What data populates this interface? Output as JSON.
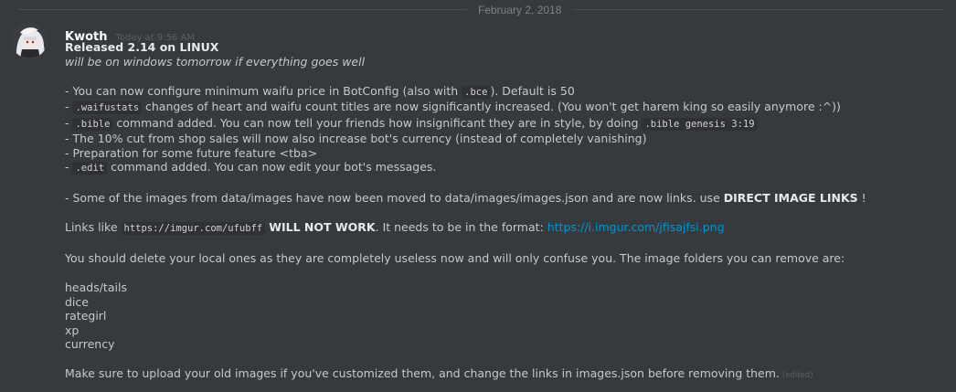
{
  "divider": {
    "date": "February 2, 2018"
  },
  "message": {
    "author": "Kwoth",
    "timestamp": "Today at 9:56 AM",
    "title": "Released 2.14 on LINUX",
    "subtitle": "will be on windows tomorrow if everything goes well",
    "changes": [
      {
        "pre": "- You can now configure minimum waifu price in BotConfig (also with ",
        "code": ".bce",
        "post": "). Default is 50"
      },
      {
        "pre": "- ",
        "code": ".waifustats",
        "post": " changes of heart and waifu count titles are now significantly increased. (You won't get harem king so easily anymore :^))"
      },
      {
        "pre": "- ",
        "code": ".bible",
        "post": " command added. You can now tell your friends how insignificant they are in style, by doing ",
        "code2": ".bible genesis 3:19"
      },
      {
        "text": "- The 10% cut from shop sales will now also increase bot's currency (instead of completely vanishing)"
      },
      {
        "text": "- Preparation for some future feature <tba>"
      },
      {
        "pre": "- ",
        "code": ".edit",
        "post": " command added. You can now edit your bot's messages."
      }
    ],
    "images_line": {
      "pre": "- Some of the images from data/images have now been moved to data/images/images.json and are now links. use ",
      "bold": "DIRECT IMAGE LINKS",
      "post": " !"
    },
    "links_line": {
      "pre": "Links like ",
      "code": "https://imgur.com/ufubff",
      "bold": "WILL NOT WORK",
      "mid": ". It needs to be in the format: ",
      "link": "https://i.imgur.com/jfisajfsi.png"
    },
    "delete_line": "You should delete your local ones as they are completely useless now and will only confuse you. The image folders you can remove are:",
    "folders": [
      "heads/tails",
      "dice",
      "rategirl",
      "xp",
      "currency"
    ],
    "final_line": "Make sure to upload your old images if you've customized them, and change the links in images.json before removing them.",
    "edited_label": "(edited)"
  },
  "colors": {
    "background": "#36393e",
    "link": "#0096cf",
    "username": "#ffffff",
    "text": "#c7c8ca"
  }
}
